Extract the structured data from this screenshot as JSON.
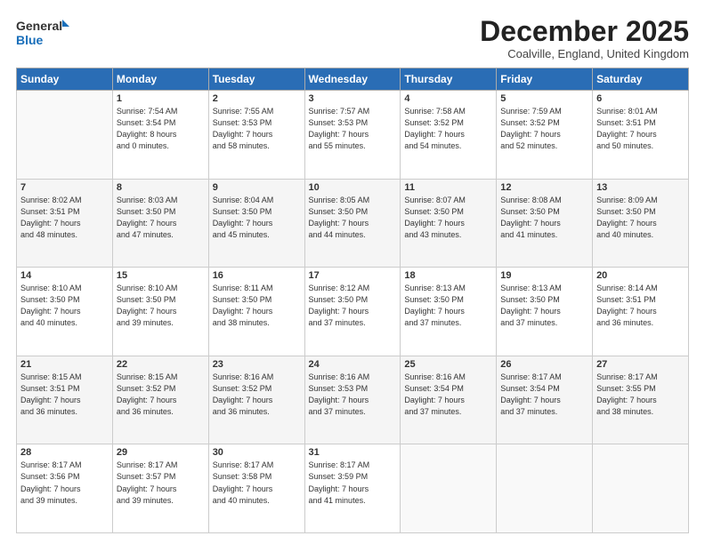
{
  "logo": {
    "line1": "General",
    "line2": "Blue"
  },
  "title": "December 2025",
  "subtitle": "Coalville, England, United Kingdom",
  "days_of_week": [
    "Sunday",
    "Monday",
    "Tuesday",
    "Wednesday",
    "Thursday",
    "Friday",
    "Saturday"
  ],
  "weeks": [
    [
      {
        "day": "",
        "info": ""
      },
      {
        "day": "1",
        "info": "Sunrise: 7:54 AM\nSunset: 3:54 PM\nDaylight: 8 hours\nand 0 minutes."
      },
      {
        "day": "2",
        "info": "Sunrise: 7:55 AM\nSunset: 3:53 PM\nDaylight: 7 hours\nand 58 minutes."
      },
      {
        "day": "3",
        "info": "Sunrise: 7:57 AM\nSunset: 3:53 PM\nDaylight: 7 hours\nand 55 minutes."
      },
      {
        "day": "4",
        "info": "Sunrise: 7:58 AM\nSunset: 3:52 PM\nDaylight: 7 hours\nand 54 minutes."
      },
      {
        "day": "5",
        "info": "Sunrise: 7:59 AM\nSunset: 3:52 PM\nDaylight: 7 hours\nand 52 minutes."
      },
      {
        "day": "6",
        "info": "Sunrise: 8:01 AM\nSunset: 3:51 PM\nDaylight: 7 hours\nand 50 minutes."
      }
    ],
    [
      {
        "day": "7",
        "info": "Sunrise: 8:02 AM\nSunset: 3:51 PM\nDaylight: 7 hours\nand 48 minutes."
      },
      {
        "day": "8",
        "info": "Sunrise: 8:03 AM\nSunset: 3:50 PM\nDaylight: 7 hours\nand 47 minutes."
      },
      {
        "day": "9",
        "info": "Sunrise: 8:04 AM\nSunset: 3:50 PM\nDaylight: 7 hours\nand 45 minutes."
      },
      {
        "day": "10",
        "info": "Sunrise: 8:05 AM\nSunset: 3:50 PM\nDaylight: 7 hours\nand 44 minutes."
      },
      {
        "day": "11",
        "info": "Sunrise: 8:07 AM\nSunset: 3:50 PM\nDaylight: 7 hours\nand 43 minutes."
      },
      {
        "day": "12",
        "info": "Sunrise: 8:08 AM\nSunset: 3:50 PM\nDaylight: 7 hours\nand 41 minutes."
      },
      {
        "day": "13",
        "info": "Sunrise: 8:09 AM\nSunset: 3:50 PM\nDaylight: 7 hours\nand 40 minutes."
      }
    ],
    [
      {
        "day": "14",
        "info": "Sunrise: 8:10 AM\nSunset: 3:50 PM\nDaylight: 7 hours\nand 40 minutes."
      },
      {
        "day": "15",
        "info": "Sunrise: 8:10 AM\nSunset: 3:50 PM\nDaylight: 7 hours\nand 39 minutes."
      },
      {
        "day": "16",
        "info": "Sunrise: 8:11 AM\nSunset: 3:50 PM\nDaylight: 7 hours\nand 38 minutes."
      },
      {
        "day": "17",
        "info": "Sunrise: 8:12 AM\nSunset: 3:50 PM\nDaylight: 7 hours\nand 37 minutes."
      },
      {
        "day": "18",
        "info": "Sunrise: 8:13 AM\nSunset: 3:50 PM\nDaylight: 7 hours\nand 37 minutes."
      },
      {
        "day": "19",
        "info": "Sunrise: 8:13 AM\nSunset: 3:50 PM\nDaylight: 7 hours\nand 37 minutes."
      },
      {
        "day": "20",
        "info": "Sunrise: 8:14 AM\nSunset: 3:51 PM\nDaylight: 7 hours\nand 36 minutes."
      }
    ],
    [
      {
        "day": "21",
        "info": "Sunrise: 8:15 AM\nSunset: 3:51 PM\nDaylight: 7 hours\nand 36 minutes."
      },
      {
        "day": "22",
        "info": "Sunrise: 8:15 AM\nSunset: 3:52 PM\nDaylight: 7 hours\nand 36 minutes."
      },
      {
        "day": "23",
        "info": "Sunrise: 8:16 AM\nSunset: 3:52 PM\nDaylight: 7 hours\nand 36 minutes."
      },
      {
        "day": "24",
        "info": "Sunrise: 8:16 AM\nSunset: 3:53 PM\nDaylight: 7 hours\nand 37 minutes."
      },
      {
        "day": "25",
        "info": "Sunrise: 8:16 AM\nSunset: 3:54 PM\nDaylight: 7 hours\nand 37 minutes."
      },
      {
        "day": "26",
        "info": "Sunrise: 8:17 AM\nSunset: 3:54 PM\nDaylight: 7 hours\nand 37 minutes."
      },
      {
        "day": "27",
        "info": "Sunrise: 8:17 AM\nSunset: 3:55 PM\nDaylight: 7 hours\nand 38 minutes."
      }
    ],
    [
      {
        "day": "28",
        "info": "Sunrise: 8:17 AM\nSunset: 3:56 PM\nDaylight: 7 hours\nand 39 minutes."
      },
      {
        "day": "29",
        "info": "Sunrise: 8:17 AM\nSunset: 3:57 PM\nDaylight: 7 hours\nand 39 minutes."
      },
      {
        "day": "30",
        "info": "Sunrise: 8:17 AM\nSunset: 3:58 PM\nDaylight: 7 hours\nand 40 minutes."
      },
      {
        "day": "31",
        "info": "Sunrise: 8:17 AM\nSunset: 3:59 PM\nDaylight: 7 hours\nand 41 minutes."
      },
      {
        "day": "",
        "info": ""
      },
      {
        "day": "",
        "info": ""
      },
      {
        "day": "",
        "info": ""
      }
    ]
  ]
}
